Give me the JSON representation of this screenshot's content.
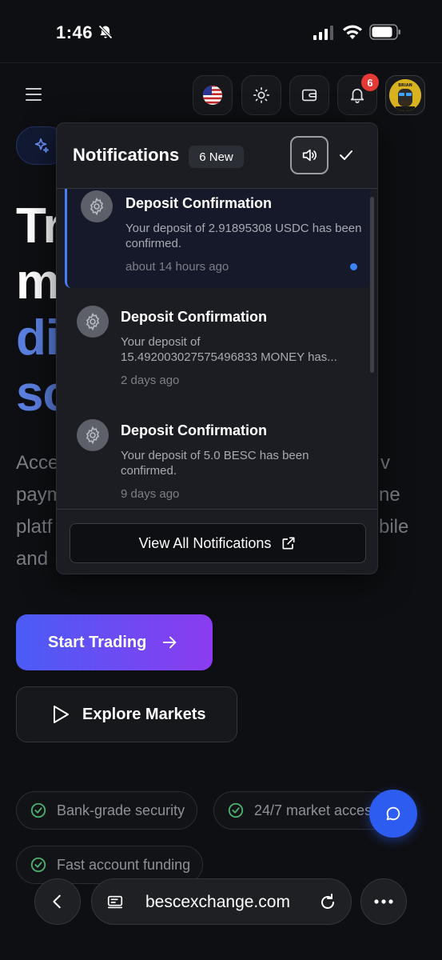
{
  "status_bar": {
    "time": "1:46"
  },
  "header": {
    "notification_count": "6",
    "avatar_text": "BRIAN"
  },
  "hero": {
    "line1": "Tr",
    "line2": "m",
    "line3": "di",
    "line4": "sc",
    "sub1": "Acce",
    "sub1_right": "v",
    "sub2": "paym",
    "sub2_right": "ne",
    "sub3": "platf",
    "sub3_right": "bile",
    "sub4": "and"
  },
  "cta": {
    "primary": "Start Trading",
    "secondary": "Explore Markets"
  },
  "features": [
    "Bank-grade security",
    "24/7 market access",
    "Fast account funding"
  ],
  "notifications_panel": {
    "title": "Notifications",
    "new_badge": "6 New",
    "view_all": "View All Notifications",
    "items": [
      {
        "title": "Deposit Confirmation",
        "body": "Your deposit of 2.91895308 USDC has been confirmed.",
        "time": "about 14 hours ago",
        "unread": true
      },
      {
        "title": "Deposit Confirmation",
        "body_line1": "Your deposit of",
        "body_line2": "15.492003027575496833 MONEY has...",
        "time": "2 days ago",
        "unread": false
      },
      {
        "title": "Deposit Confirmation",
        "body": "Your deposit of 5.0 BESC has been confirmed.",
        "time": "9 days ago",
        "unread": false
      }
    ]
  },
  "browser": {
    "url": "bescexchange.com"
  },
  "colors": {
    "accent": "#4a7cf5",
    "badge": "#e53935",
    "cta_start": "#4b5cf6",
    "cta_end": "#8b3cf0",
    "success": "#4caf6e"
  }
}
